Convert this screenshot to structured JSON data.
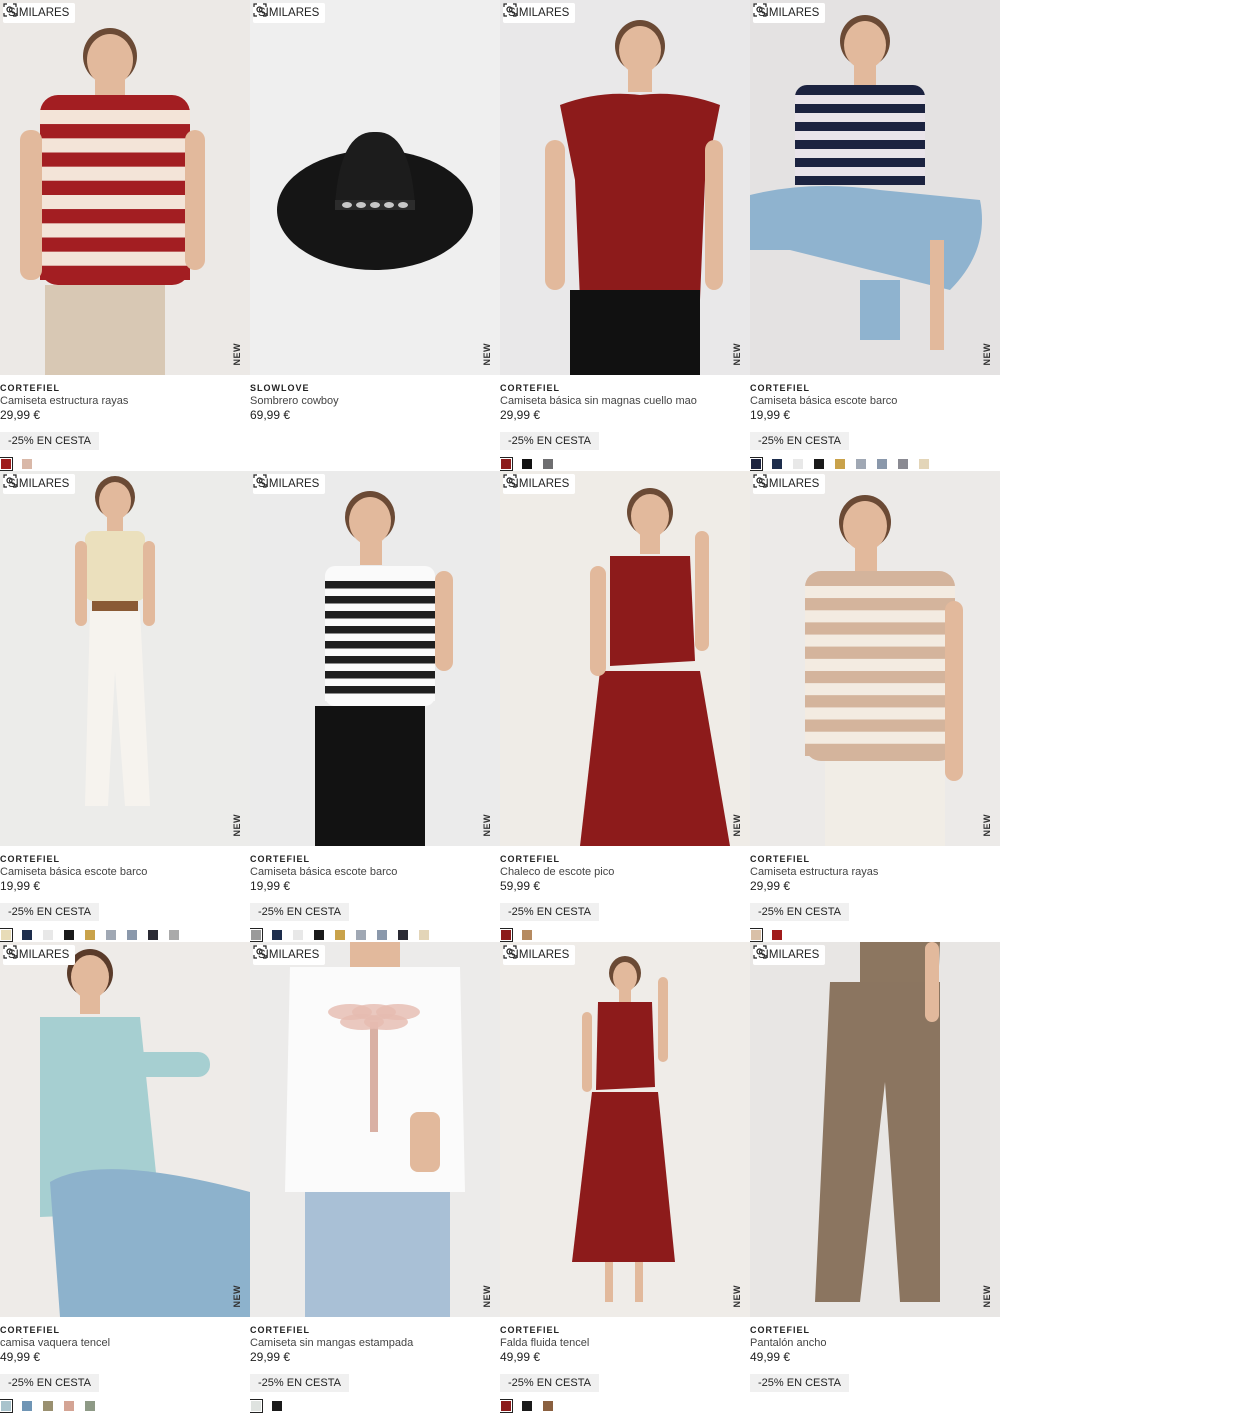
{
  "similar_label": "SIMILARES",
  "new_label": "NEW",
  "products": [
    {
      "brand": "CORTEFIEL",
      "name": "Camiseta estructura rayas",
      "price": "29,99 €",
      "promo": "-25% EN CESTA",
      "bg": "#ece9e6",
      "look": "stripes-red",
      "colors": [
        "#9e1b1b",
        "#d9b8a8"
      ]
    },
    {
      "brand": "SLOWLOVE",
      "name": "Sombrero cowboy",
      "price": "69,99 €",
      "promo": "",
      "bg": "#efefef",
      "look": "hat",
      "colors": []
    },
    {
      "brand": "CORTEFIEL",
      "name": "Camiseta básica sin magnas cuello mao",
      "price": "29,99 €",
      "promo": "-25% EN CESTA",
      "bg": "#e9e8e9",
      "look": "red-top",
      "colors": [
        "#8c1a1a",
        "#111111",
        "#6e6e70"
      ]
    },
    {
      "brand": "CORTEFIEL",
      "name": "Camiseta básica escote barco",
      "price": "19,99 €",
      "promo": "-25% EN CESTA",
      "bg": "#e4e2e2",
      "look": "navy-stripe-seated",
      "colors": [
        "#1c2340",
        "#1d2d4c",
        "#e8e8e8",
        "#1a1a1a",
        "#c9a24a",
        "#a0a8b4",
        "#8a98ab",
        "#8a8a92",
        "#e3d5b8"
      ]
    },
    {
      "brand": "CORTEFIEL",
      "name": "Camiseta básica escote barco",
      "price": "19,99 €",
      "promo": "-25% EN CESTA",
      "bg": "#ececea",
      "look": "beige-top",
      "colors": [
        "#e8dcb8",
        "#1d2d4c",
        "#e8e8e8",
        "#1a1a1a",
        "#c9a24a",
        "#a0a8b4",
        "#8a98ab",
        "#2a2a34",
        "#aaaaaa"
      ]
    },
    {
      "brand": "CORTEFIEL",
      "name": "Camiseta básica escote barco",
      "price": "19,99 €",
      "promo": "-25% EN CESTA",
      "bg": "#ebebeb",
      "look": "bw-stripe",
      "colors": [
        "#9a9a9a",
        "#1d2d4c",
        "#e8e8e8",
        "#1a1a1a",
        "#c9a24a",
        "#a0a8b4",
        "#8a98ab",
        "#2a2a34",
        "#e3d5b8"
      ]
    },
    {
      "brand": "CORTEFIEL",
      "name": "Chaleco de escote pico",
      "price": "59,99 €",
      "promo": "-25% EN CESTA",
      "bg": "#efece7",
      "look": "red-vest",
      "colors": [
        "#8c1a1a",
        "#b58a60"
      ]
    },
    {
      "brand": "CORTEFIEL",
      "name": "Camiseta estructura rayas",
      "price": "29,99 €",
      "promo": "-25% EN CESTA",
      "bg": "#eceae8",
      "look": "beige-stripe",
      "colors": [
        "#d9c0a8",
        "#a01b1b"
      ]
    },
    {
      "brand": "CORTEFIEL",
      "name": "camisa vaquera tencel",
      "price": "49,99 €",
      "promo": "-25% EN CESTA",
      "bg": "#eeebe8",
      "look": "denim-shirt",
      "colors": [
        "#a9c3cc",
        "#6f95b5",
        "#9a9070",
        "#d4a494",
        "#8e9a86"
      ]
    },
    {
      "brand": "CORTEFIEL",
      "name": "Camiseta sin mangas estampada",
      "price": "29,99 €",
      "promo": "-25% EN CESTA",
      "bg": "#ecebea",
      "look": "palm-tee",
      "colors": [
        "#dfe3e0",
        "#1a1a1a"
      ]
    },
    {
      "brand": "CORTEFIEL",
      "name": "Falda fluida tencel",
      "price": "49,99 €",
      "promo": "-25% EN CESTA",
      "bg": "#efece8",
      "look": "red-skirt",
      "colors": [
        "#8c1a1a",
        "#1a1a1a",
        "#8a6040"
      ]
    },
    {
      "brand": "CORTEFIEL",
      "name": "Pantalón ancho",
      "price": "49,99 €",
      "promo": "-25% EN CESTA",
      "bg": "#e8e6e4",
      "look": "brown-pants",
      "colors": []
    }
  ]
}
